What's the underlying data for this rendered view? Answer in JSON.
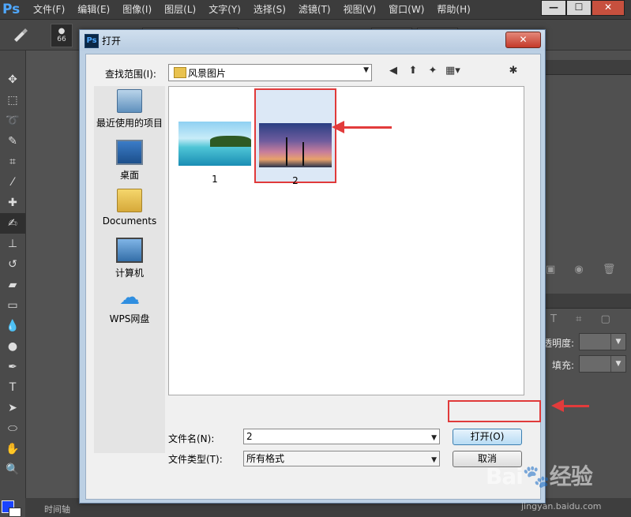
{
  "app": {
    "logo": "Ps",
    "menu": [
      "文件(F)",
      "编辑(E)",
      "图像(I)",
      "图层(L)",
      "文字(Y)",
      "选择(S)",
      "滤镜(T)",
      "视图(V)",
      "窗口(W)",
      "帮助(H)"
    ],
    "brush_size": "66",
    "window_buttons": [
      "—",
      "☐",
      "✕"
    ]
  },
  "right_panel": {
    "opacity_label": "透明度:",
    "fill_label": "填充:"
  },
  "bottom": {
    "timeline_label": "时间轴"
  },
  "watermark": {
    "main": "Bai🐾经验",
    "sub": "jingyan.baidu.com"
  },
  "dialog": {
    "title": "打开",
    "close_label": "✕",
    "look_in_label": "查找范围(I):",
    "look_in_value": "风景图片",
    "places": [
      {
        "label": "最近使用的项目",
        "icon": "recent-items-icon"
      },
      {
        "label": "桌面",
        "icon": "desktop-icon"
      },
      {
        "label": "Documents",
        "icon": "documents-folder-icon"
      },
      {
        "label": "计算机",
        "icon": "computer-icon"
      },
      {
        "label": "WPS网盘",
        "icon": "cloud-drive-icon"
      }
    ],
    "files": [
      {
        "name": "1"
      },
      {
        "name": "2",
        "selected": true
      }
    ],
    "filename_label": "文件名(N):",
    "filename_value": "2",
    "filetype_label": "文件类型(T):",
    "filetype_value": "所有格式",
    "open_button": "打开(O)",
    "cancel_button": "取消"
  },
  "colors": {
    "annotation_red": "#e23b3b",
    "dialog_frame": "#bcd0e4",
    "ps_background": "#535353"
  }
}
